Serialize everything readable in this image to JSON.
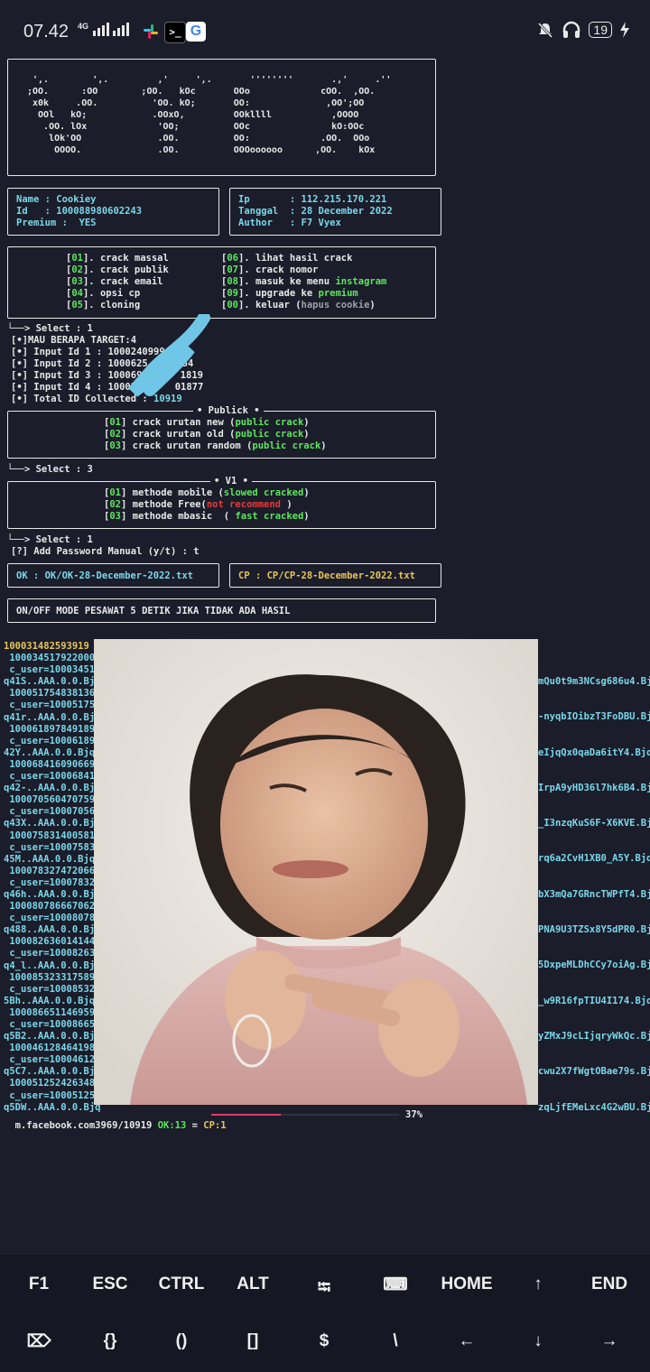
{
  "status_bar": {
    "time": "07.42",
    "network": "4G",
    "battery": "19",
    "icons": [
      "slack-icon",
      "terminal-icon",
      "google-icon",
      "mute-icon",
      "headset-icon",
      "charging-icon"
    ]
  },
  "logo_ascii": " ',.        ',.         ,'     ',.       ''''''''       .,'     .'' \n;OO.      :OO        ;OO.   kOc       OOo             cOO.  ,OO.\n x0k     .OO.          'OO. kO;       OO:              ,OO';OO \n  OOl   kO;            .OOxO,         OOkllll           ,OOOO \n   .OO. lOx             'OO;          OOc               kO:OOc\n    lOk'OO              .OO.          OO:             .OO.  OOo\n     OOOO.              .OO.          OOOoooooo      ,OO.    kOx",
  "user": {
    "name": "Name : Cookiey",
    "id": "Id   : 100088980602243",
    "premium": "Premium :  YES"
  },
  "info": {
    "ip": "Ip       : 112.215.170.221",
    "date": "Tanggal  : 28 December 2022",
    "author": "Author   : F7 Vyex"
  },
  "menu": {
    "left": [
      {
        "num": "01",
        "label": "crack massal"
      },
      {
        "num": "02",
        "label": "crack publik"
      },
      {
        "num": "03",
        "label": "crack email"
      },
      {
        "num": "04",
        "label": "opsi cp"
      },
      {
        "num": "05",
        "label": "cloning"
      }
    ],
    "right": [
      {
        "num": "06",
        "label": "lihat hasil crack",
        "extra": ""
      },
      {
        "num": "07",
        "label": "crack nomor",
        "extra": ""
      },
      {
        "num": "08",
        "label": "masuk ke menu ",
        "extra": "instagram"
      },
      {
        "num": "09",
        "label": "upgrade ke ",
        "extra": "premium"
      },
      {
        "num": "00",
        "label": "keluar (",
        "extra": "hapus cookie",
        ")": ")"
      }
    ]
  },
  "select1": "└──> Select : 1",
  "target_lines": [
    "[•]MAU BERAPA TARGET:4",
    "[•] Input Id 1 : 1000240999",
    "[•] Input Id 2 : 1000625",
    "[•] Input Id 3 : 1000695",
    "[•] Input Id 4 : 1000347"
  ],
  "target_tails": [
    "",
    "54",
    "1819",
    "01877"
  ],
  "total_label": "[•] Total ID Collected : ",
  "total_value": "10919",
  "publick": {
    "title": "• Publick •",
    "items": [
      {
        "num": "01",
        "label": "crack urutan new (",
        "hl": "public crack",
        ")": ")"
      },
      {
        "num": "02",
        "label": "crack urutan old (",
        "hl": "public crack"
      },
      {
        "num": "03",
        "label": "crack urutan random (",
        "hl": "public crack"
      }
    ]
  },
  "select3": "└──> Select : 3",
  "v1": {
    "title": "• V1 •",
    "items": [
      {
        "num": "01",
        "label": "methode mobile (",
        "hl": "slowed cracked",
        "close": ")"
      },
      {
        "num": "02",
        "label": "methode Free(",
        "hl": "not recommend",
        "close": " )"
      },
      {
        "num": "03",
        "label": "methode mbasic  ( ",
        "hl": "fast cracked",
        "close": ")"
      }
    ]
  },
  "select1b": "└──> Select : 1",
  "password_prompt": "[?] Add Password Manual (y/t) : t",
  "ok_file": "OK : OK/OK-28-December-2022.txt",
  "cp_file": "CP : CP/CP-28-December-2022.txt",
  "airplane_notice": "ON/OFF MODE PESAWAT 5 DETIK JIKA TIDAK ADA HASIL",
  "results": {
    "left": [
      "100031482593919",
      " 100034517922000",
      " c_user=100034517",
      "q41S..AAA.0.0.Bjq",
      " 100051754838136",
      " c_user=100051754",
      "q41r..AAA.0.0.Bjq",
      " 100061897849189",
      " c_user=100061897",
      "42Y..AAA.0.0.Bjq",
      " 100068416090669",
      " c_user=100068416",
      "q42-..AAA.0.0.Bjq",
      " 100070560470759",
      " c_user=100070560",
      "q43X..AAA.0.0.Bjq",
      " 100075831400581",
      " c_user=100075831",
      "45M..AAA.0.0.Bjq",
      " 100078327472066",
      " c_user=100078327",
      "q46h..AAA.0.0.Bjq",
      " 100080786667062",
      " c_user=100080786",
      "q488..AAA.0.0.Bjq",
      " 100082636014144",
      " c_user=100082636",
      "q4_l..AAA.0.0.Bjq",
      " 100085323317589",
      " c_user=100085323",
      "5Bh..AAA.0.0.Bjq",
      " 100086651146959",
      " c_user=100086651",
      "q5B2..AAA.0.0.Bjq",
      " 100046128464198",
      " c_user=100046128",
      "q5C7..AAA.0.0.Bjq",
      " 100051252426348",
      " c_user=100051252",
      "q5DW..AAA.0.0.Bjq"
    ],
    "right": [
      "mQu0t9m3NCsg686u4.Bj",
      "-nyqbIOibzT3FoDBU.Bj",
      "eIjqQx0qaDa6itY4.Bjq",
      "IrpA9yHD36l7hk6B4.Bj",
      "_I3nzqKuS6F-X6KVE.Bj",
      "rq6a2CvH1XB0_A5Y.Bjq",
      "bX3mQa7GRncTWPfT4.Bj",
      "PNA9U3TZSx8Y5dPR0.Bj",
      "5DxpeMLDhCCy7oiAg.Bj",
      "_w9R16fpTIU4I174.Bjq",
      "yZMxJ9cLIjqryWkQc.Bj",
      "cwu2X7fWgtOBae79s.Bj",
      "zqLjfEMeLxc4G2wBU.Bj"
    ]
  },
  "progress": {
    "prefix": "m.facebook.com3969/10919 ",
    "ok": "OK:13",
    "sep": " = ",
    "cp": "CP:1",
    "percent_text": "37%",
    "fraction": 0.37
  },
  "extra_keys": {
    "row1": [
      "F1",
      "ESC",
      "CTRL",
      "ALT",
      "⭾",
      "⌨",
      "HOME",
      "↑",
      "END"
    ],
    "row2": [
      "⌦",
      "{}",
      "()",
      "[]",
      "$",
      "\\",
      "←",
      "↓",
      "→"
    ]
  }
}
